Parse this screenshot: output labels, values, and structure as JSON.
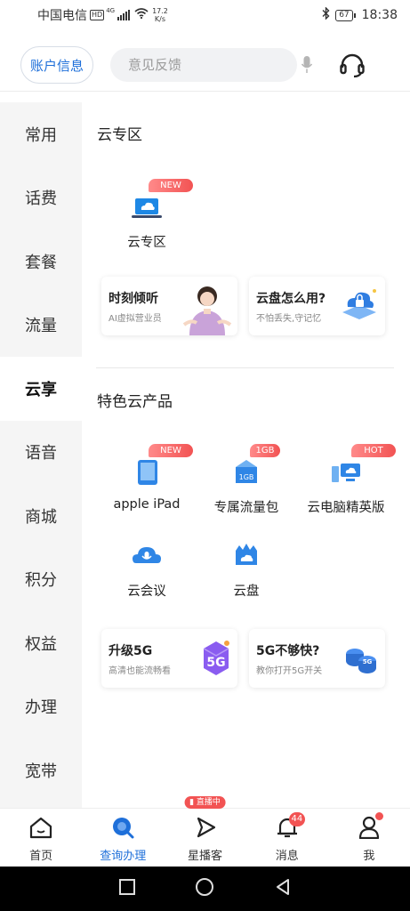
{
  "status_bar": {
    "carrier": "中国电信",
    "hd": "HD",
    "network": "4G",
    "speed_value": "17.2",
    "speed_unit": "K/s",
    "battery": "67",
    "time": "18:38"
  },
  "header": {
    "account_label": "账户信息",
    "search_placeholder": "意见反馈"
  },
  "sidebar": {
    "items": [
      {
        "label": "常用"
      },
      {
        "label": "话费"
      },
      {
        "label": "套餐"
      },
      {
        "label": "流量"
      },
      {
        "label": "云享"
      },
      {
        "label": "语音"
      },
      {
        "label": "商城"
      },
      {
        "label": "积分"
      },
      {
        "label": "权益"
      },
      {
        "label": "办理"
      },
      {
        "label": "宽带"
      }
    ],
    "active": "云享"
  },
  "zone": {
    "title": "云专区",
    "tiles": [
      {
        "label": "云专区",
        "badge": "NEW",
        "icon": "cloud-laptop-icon"
      }
    ],
    "cards": [
      {
        "title": "时刻倾听",
        "subtitle": "AI虚拟营业员"
      },
      {
        "title": "云盘怎么用?",
        "subtitle": "不怕丢失,守记忆"
      }
    ]
  },
  "products": {
    "title": "特色云产品",
    "tiles": [
      {
        "label": "apple iPad",
        "badge": "NEW",
        "icon": "tablet-icon"
      },
      {
        "label": "专属流量包",
        "badge": "1GB",
        "icon": "data-pack-icon"
      },
      {
        "label": "云电脑精英版",
        "badge": "HOT",
        "icon": "cloud-pc-icon"
      },
      {
        "label": "云会议",
        "badge": "",
        "icon": "cloud-meeting-icon"
      },
      {
        "label": "云盘",
        "badge": "",
        "icon": "cloud-drive-icon"
      }
    ],
    "cards": [
      {
        "title": "升级5G",
        "subtitle": "高清也能流畅看"
      },
      {
        "title": "5G不够快?",
        "subtitle": "教你打开5G开关"
      }
    ]
  },
  "bottom_nav": {
    "items": [
      {
        "label": "首页"
      },
      {
        "label": "查询办理"
      },
      {
        "label": "星播客"
      },
      {
        "label": "消息"
      },
      {
        "label": "我"
      }
    ],
    "live_badge": "直播中",
    "message_count": "44"
  },
  "colors": {
    "accent": "#1e6fd9",
    "badge": "#f25353"
  }
}
